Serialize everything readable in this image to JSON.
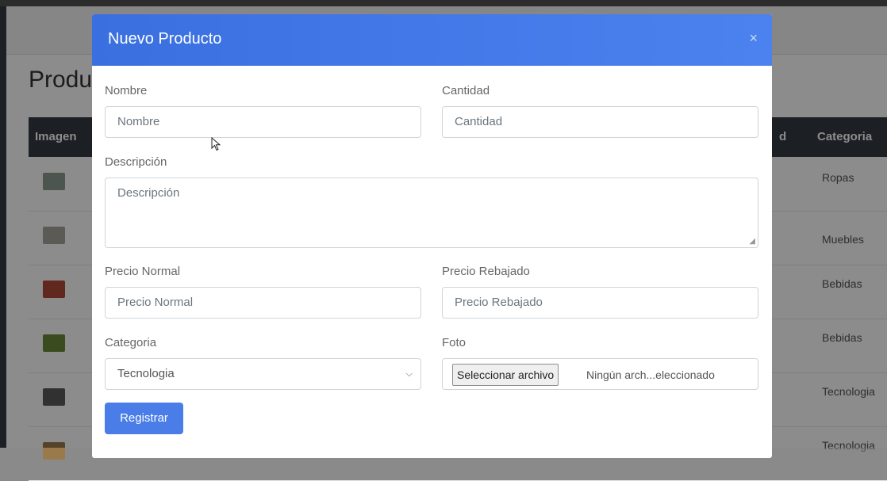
{
  "background_page": {
    "title": "Produ",
    "table_headers": {
      "image": "Imagen",
      "quantity_partial": "d",
      "category": "Categoria"
    },
    "rows": [
      {
        "category": "Ropas",
        "thumb_color": "#8a9c8f"
      },
      {
        "category": "Muebles",
        "thumb_color": "#a7a59a"
      },
      {
        "category": "Bebidas",
        "thumb_color": "#b04a3a"
      },
      {
        "category": "Bebidas",
        "thumb_color": "#6a8a3a"
      },
      {
        "category": "Tecnologia",
        "thumb_color": "#5a5a5a"
      },
      {
        "category": "Tecnologia",
        "thumb_color": "#9a7a4a"
      }
    ]
  },
  "modal": {
    "title": "Nuevo Producto",
    "close_icon": "×",
    "fields": {
      "nombre": {
        "label": "Nombre",
        "placeholder": "Nombre"
      },
      "cantidad": {
        "label": "Cantidad",
        "placeholder": "Cantidad"
      },
      "descripcion": {
        "label": "Descripción",
        "placeholder": "Descripción"
      },
      "precio_normal": {
        "label": "Precio Normal",
        "placeholder": "Precio Normal"
      },
      "precio_rebajado": {
        "label": "Precio Rebajado",
        "placeholder": "Precio Rebajado"
      },
      "categoria": {
        "label": "Categoria",
        "selected": "Tecnologia"
      },
      "foto": {
        "label": "Foto",
        "button": "Seleccionar archivo",
        "status": "Ningún arch...eleccionado"
      }
    },
    "submit_label": "Registrar"
  },
  "colors": {
    "header": "#3a6fe0",
    "button": "#4a7de8",
    "table_header": "#343a40"
  }
}
